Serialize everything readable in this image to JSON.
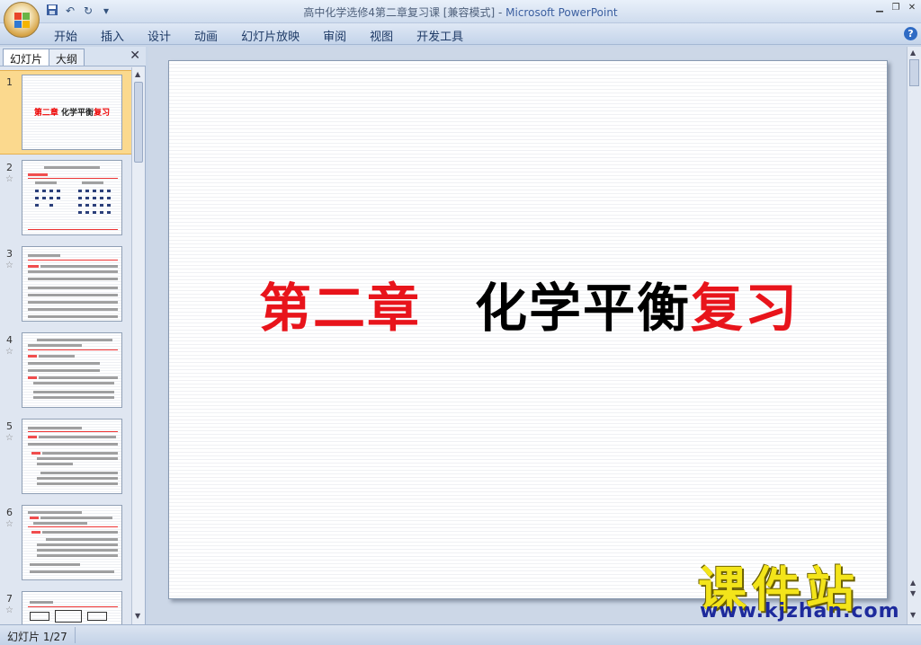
{
  "window": {
    "title": "高中化学选修4第二章复习课 [兼容模式] - ",
    "app_name": "Microsoft PowerPoint"
  },
  "ribbon": {
    "tabs": [
      {
        "label": "开始"
      },
      {
        "label": "插入"
      },
      {
        "label": "设计"
      },
      {
        "label": "动画"
      },
      {
        "label": "幻灯片放映"
      },
      {
        "label": "审阅"
      },
      {
        "label": "视图"
      },
      {
        "label": "开发工具"
      }
    ],
    "help": "?"
  },
  "panel": {
    "tab_slides": "幻灯片",
    "tab_outline": "大纲",
    "close": "✕"
  },
  "thumbnails": [
    {
      "num": "1",
      "title_red": "第二章",
      "title_black": " 化学平衡",
      "title_red2": "复习"
    },
    {
      "num": "2",
      "star": "☆"
    },
    {
      "num": "3",
      "star": "☆"
    },
    {
      "num": "4",
      "star": "☆"
    },
    {
      "num": "5",
      "star": "☆"
    },
    {
      "num": "6",
      "star": "☆"
    },
    {
      "num": "7",
      "star": "☆"
    }
  ],
  "slide": {
    "title_part1": "第二章",
    "title_part2": "化学平衡",
    "title_part3": "复习"
  },
  "watermark": {
    "cn": "课件站",
    "url": "www.kjzhan.com"
  },
  "status": {
    "slide_counter": "幻灯片 1/27"
  },
  "colors": {
    "title_red": "#e8141b",
    "selected_thumb": "#fbd98e"
  }
}
